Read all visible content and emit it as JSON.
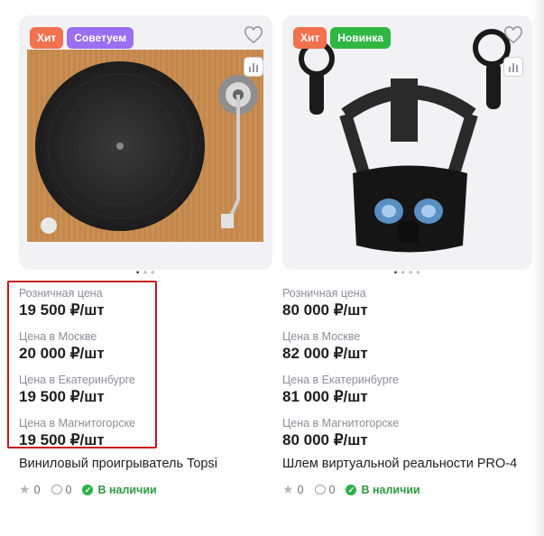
{
  "products": [
    {
      "badges": [
        {
          "label": "Хит",
          "color": "#f2714f"
        },
        {
          "label": "Советуем",
          "color": "#9b6ff2"
        }
      ],
      "prices": [
        {
          "label": "Розничная цена",
          "value": "19 500 ₽/шт"
        },
        {
          "label": "Цена в Москве",
          "value": "20 000 ₽/шт"
        },
        {
          "label": "Цена в Екатеринбурге",
          "value": "19 500 ₽/шт"
        },
        {
          "label": "Цена в Магнитогорске",
          "value": "19 500 ₽/шт"
        }
      ],
      "title": "Виниловый проигрыватель Topsi",
      "rating": "0",
      "comments": "0",
      "stock": "В наличии",
      "image_icon": "turntable"
    },
    {
      "badges": [
        {
          "label": "Хит",
          "color": "#f2714f"
        },
        {
          "label": "Новинка",
          "color": "#2fb744"
        }
      ],
      "prices": [
        {
          "label": "Розничная цена",
          "value": "80 000 ₽/шт"
        },
        {
          "label": "Цена в Москве",
          "value": "82 000 ₽/шт"
        },
        {
          "label": "Цена в Екатеринбурге",
          "value": "81 000 ₽/шт"
        },
        {
          "label": "Цена в Магнитогорске",
          "value": "80 000 ₽/шт"
        }
      ],
      "title": "Шлем виртуальной реальности PRO-4",
      "rating": "0",
      "comments": "0",
      "stock": "В наличии",
      "image_icon": "vr-headset"
    }
  ],
  "colors": {
    "highlight": "#c8151c",
    "in_stock": "#2fae4a"
  }
}
